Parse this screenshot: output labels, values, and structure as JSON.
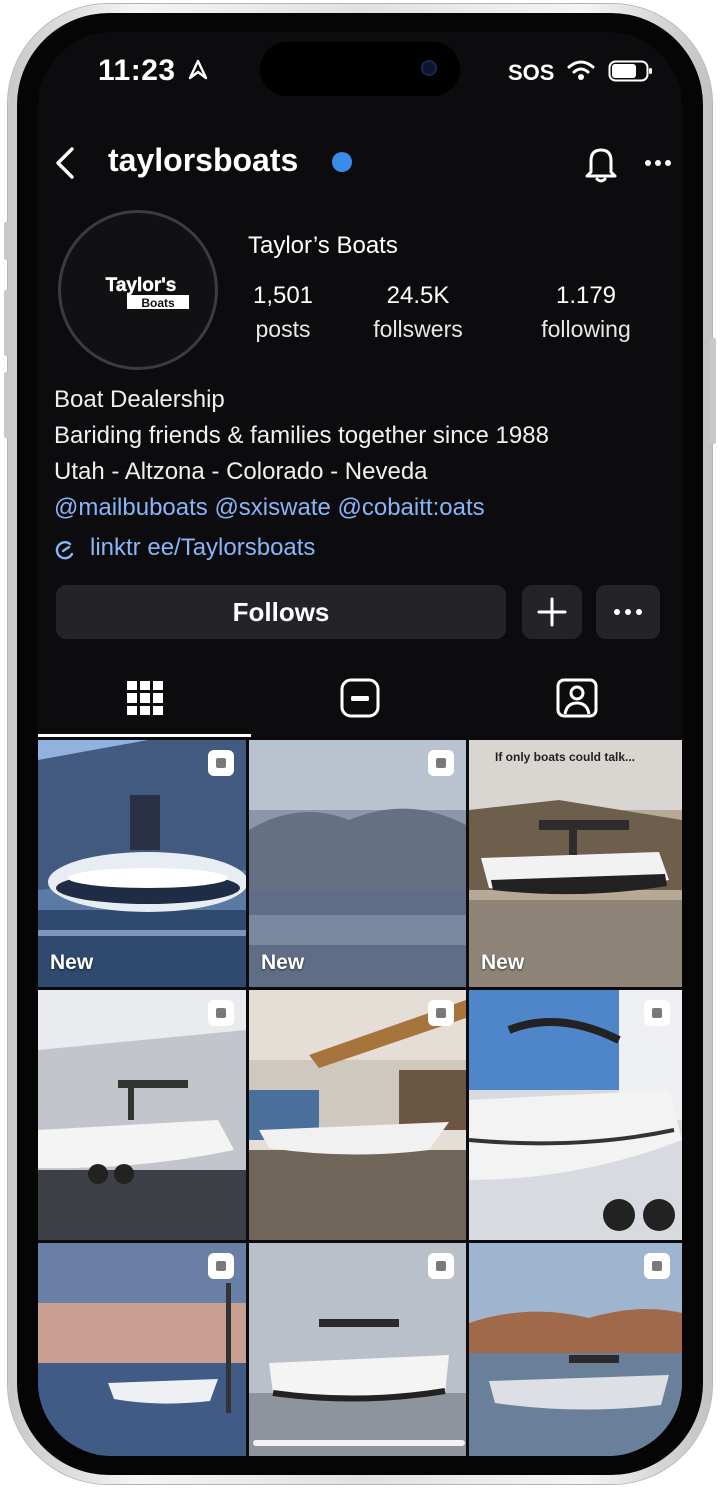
{
  "status_bar": {
    "time": "11:23",
    "carrier": "SOS"
  },
  "header": {
    "username": "taylorsboats"
  },
  "profile": {
    "display_name": "Taylor’s Boats",
    "logo_line1": "Taylor's",
    "logo_line2": "Boats",
    "stats": [
      {
        "value": "1,501",
        "label": "posts"
      },
      {
        "value": "24.5K",
        "label": "follswers"
      },
      {
        "value": "1.179",
        "label": "following"
      }
    ],
    "bio": [
      "Boat Dealership",
      "Bariding friends & families together since 1988",
      "Utah - Altzona - Colorado -  Neveda"
    ],
    "mentions": "@mailbuboats @sxiswate @cobaitt:oats",
    "link": "linktr ee/Taylorsboats"
  },
  "actions": {
    "follows_label": "Follows",
    "add_label": "+",
    "more_label": "···"
  },
  "grid": {
    "new_label": "New",
    "overlay_caption": "If only boats could talk..."
  },
  "colors": {
    "background": "#0c0c0f",
    "link": "#8ab4f8",
    "verified": "#3b8beb",
    "button": "#242428"
  }
}
